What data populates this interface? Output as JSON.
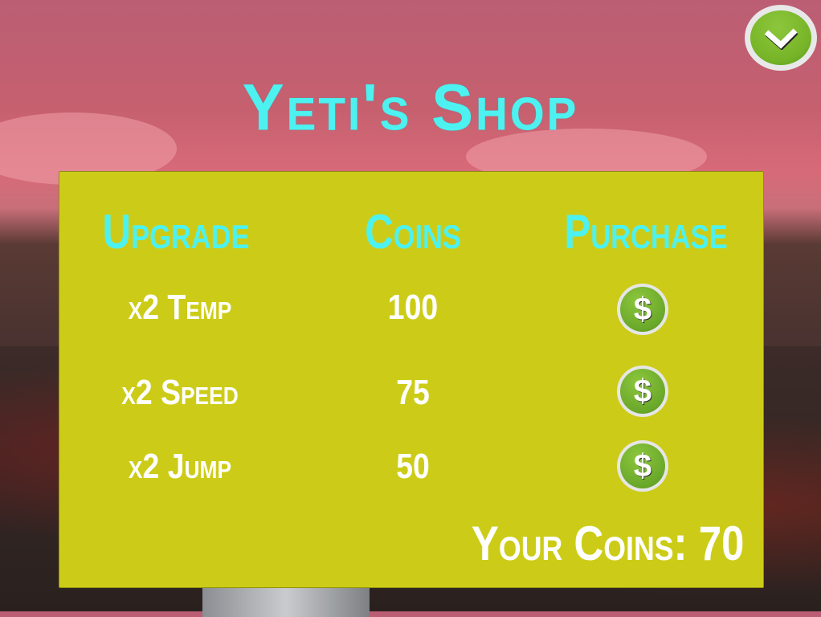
{
  "shop": {
    "title": "Yeti's Shop",
    "headers": {
      "upgrade": "Upgrade",
      "coins": "Coins",
      "purchase": "Purchase"
    },
    "items": [
      {
        "name": "x2 Temp",
        "cost": "100",
        "button_icon": "dollar-icon"
      },
      {
        "name": "x2 Speed",
        "cost": "75",
        "button_icon": "dollar-icon"
      },
      {
        "name": "x2 Jump",
        "cost": "50",
        "button_icon": "dollar-icon"
      }
    ],
    "your_coins": "Your Coins: 70",
    "confirm_icon": "checkmark-icon",
    "dollar_glyph": "$"
  },
  "colors": {
    "panel": "#cccc18",
    "title": "#4df2f0",
    "button": "#78b428",
    "sky": "#c45e72"
  }
}
